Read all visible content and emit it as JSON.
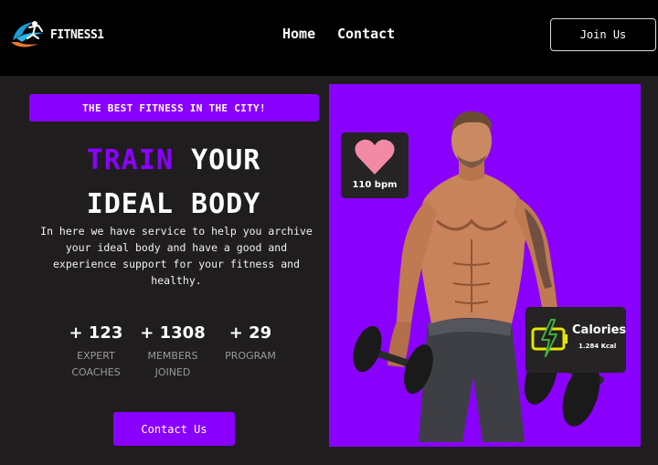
{
  "navbar": {
    "brand": "FITNESS1",
    "links": [
      {
        "label": "Home"
      },
      {
        "label": "Contact"
      }
    ],
    "join_label": "Join Us"
  },
  "hero": {
    "banner": "THE BEST FITNESS IN THE CITY!",
    "headline_accent": "TRAIN",
    "headline_rest": "YOUR",
    "headline_line2": "IDEAL BODY",
    "description": "In here we have service to help you archive your ideal body and have a good and experience support for your fitness and healthy.",
    "stats": [
      {
        "value": "+ 123",
        "label_line1": "EXPERT",
        "label_line2": "COACHES"
      },
      {
        "value": "+ 1308",
        "label_line1": "MEMBERS",
        "label_line2": "JOINED"
      },
      {
        "value": "+ 29",
        "label_line1": "PROGRAM",
        "label_line2": ""
      }
    ],
    "contact_label": "Contact Us"
  },
  "cards": {
    "heart_rate": "110 bpm",
    "calories_title": "Calories",
    "calories_value": "1.284 Kcal"
  },
  "colors": {
    "accent": "#8a00ff",
    "background": "#1f1d1d",
    "navbar": "#000000",
    "card": "#252323",
    "heart": "#f28aa5",
    "battery": "#e6e600"
  },
  "icons": {
    "logo": "runner-logo-icon",
    "heart": "heart-icon",
    "calories": "battery-charging-icon"
  }
}
